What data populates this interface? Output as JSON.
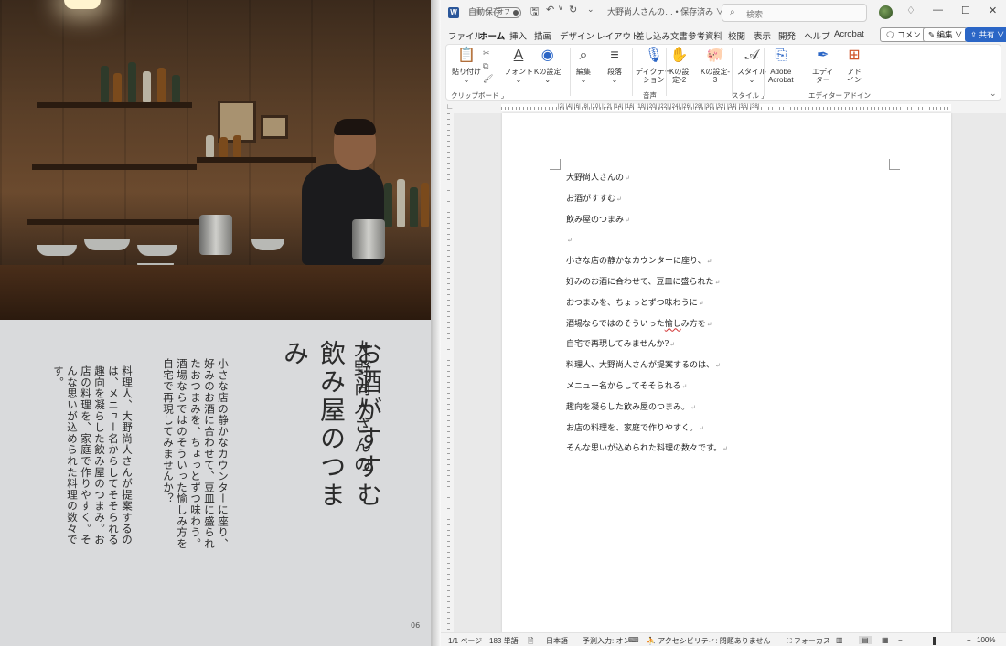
{
  "scan": {
    "title_author": "大野尚人さんの",
    "title_main": "お酒がすすむ 飲み屋のつまみ",
    "body_col1": "小さな店の静かなカウンターに座り、好みのお酒に合わせて、豆皿に盛られたおつまみを、ちょっとずつ味わう。酒場ならではのそういった愉しみ方を自宅で再現してみませんか？",
    "body_col2": "料理人、大野尚人さんが提案するのは、メニュー名からしてそそられる趣向を凝らした飲み屋のつまみ。お店の料理を、家庭で作りやすく。そんな思いが込められた料理の数々です。",
    "page_number": "06"
  },
  "titlebar": {
    "autosave_label": "自動保存",
    "autosave_state": "オフ",
    "doc_title": "大野尚人さんの… • 保存済み ∨",
    "search_placeholder": "検索"
  },
  "tabs": [
    "ファイル",
    "ホーム",
    "挿入",
    "描画",
    "デザイン",
    "レイアウト",
    "差し込み文書",
    "参考資料",
    "校閲",
    "表示",
    "開発",
    "ヘルプ",
    "Acrobat"
  ],
  "header_buttons": {
    "comment": "コメント",
    "edit": "編集 ∨",
    "share": "共有 ∨"
  },
  "ribbon": {
    "paste": "貼り付け",
    "font": "フォント",
    "k_settings": "Kの設定",
    "edit": "編集",
    "paragraph": "段落",
    "dictate": "ディクテー\nション",
    "k_settings2": "Kの設\n定-2",
    "k_settings3": "Kの設定-\n3",
    "style": "スタイル",
    "adobe_acrobat": "Adobe\nAcrobat",
    "editor": "エディ\nター",
    "addin": "アド\nイン",
    "groups": {
      "clipboard": "クリップボード",
      "voice": "音声",
      "styles": "スタイル",
      "editor": "エディター",
      "addin": "アドイン"
    }
  },
  "ruler": {
    "numbers": "|2|  |4|  |6|  |8|  |10|  |12|  |14|  |16|  |18|  |20|  |22|  |24|  |26|  |28|  |30|  |32|  |34|  |36|  |38|"
  },
  "document": {
    "lines": [
      {
        "text": "大野尚人さんの"
      },
      {
        "text": "お酒がすすむ"
      },
      {
        "text": "飲み屋のつまみ"
      },
      {
        "text": ""
      },
      {
        "text": "小さな店の静かなカウンターに座り、"
      },
      {
        "text": "好みのお酒に合わせて、豆皿に盛られた"
      },
      {
        "text": "おつまみを、ちょっとずつ味わうに"
      },
      {
        "text": "酒場ならではのそういった",
        "flag": "愉し",
        "after": "み方を"
      },
      {
        "text": "自宅で再現してみませんか?"
      },
      {
        "text": "料理人、大野尚人さんが提案するのは、"
      },
      {
        "text": "メニュー名からしてそそられる"
      },
      {
        "text": "趣向を凝らした飲み屋のつまみ。"
      },
      {
        "text": "お店の料理を、家庭で作りやすく。"
      },
      {
        "text": "そんな思いが込められた料理の数々です。"
      }
    ],
    "para_mark": "↵"
  },
  "statusbar": {
    "page": "1/1 ページ",
    "words": "183 単語",
    "language": "日本語",
    "predictive": "予測入力: オン",
    "accessibility": "アクセシビリティ: 問題ありません",
    "focus": "フォーカス",
    "zoom": "100%"
  },
  "colors": {
    "word_blue": "#2b579a",
    "share_blue": "#2b66c6",
    "spell_red": "#d03030"
  }
}
